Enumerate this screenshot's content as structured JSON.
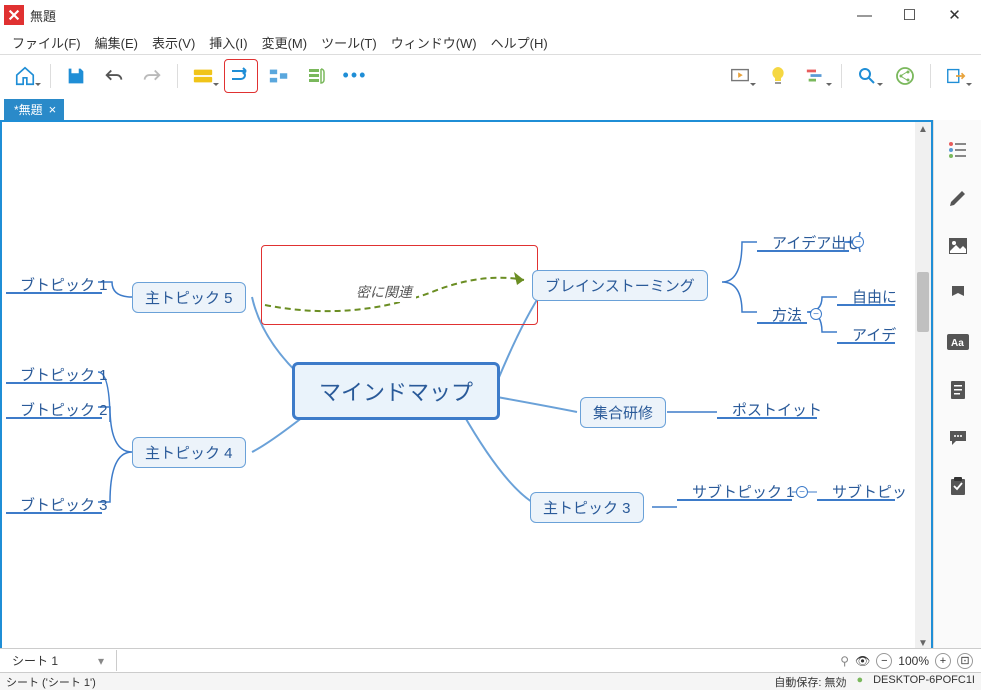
{
  "window": {
    "title": "無題"
  },
  "menu": {
    "file": "ファイル(F)",
    "edit": "編集(E)",
    "view": "表示(V)",
    "insert": "挿入(I)",
    "modify": "変更(M)",
    "tools": "ツール(T)",
    "window": "ウィンドウ(W)",
    "help": "ヘルプ(H)"
  },
  "tabs": {
    "active": "*無題",
    "close": "×"
  },
  "mindmap": {
    "central": "マインドマップ",
    "topic5": "主トピック 5",
    "topic4": "主トピック 4",
    "topic3": "主トピック 3",
    "brainstorm": "ブレインストーミング",
    "group_training": "集合研修",
    "relationship_label": "密に関連",
    "sub_btopic1_a": "ブトピック 1",
    "sub_btopic1_b": "ブトピック 1",
    "sub_btopic2": "ブトピック 2",
    "sub_btopic3": "ブトピック 3",
    "idea_out": "アイデア出し",
    "method": "方法",
    "freely": "自由に",
    "idea_partial": "アイデ",
    "postit": "ポストイット",
    "subtopic1": "サブトピック 1",
    "subtopic_partial": "サブトピッ"
  },
  "sheet": {
    "name": "シート 1",
    "zoom": "100%"
  },
  "status": {
    "sheet_info": "シート ('シート 1')",
    "autosave": "自動保存: 無効",
    "desktop": "DESKTOP-6POFC1I"
  }
}
